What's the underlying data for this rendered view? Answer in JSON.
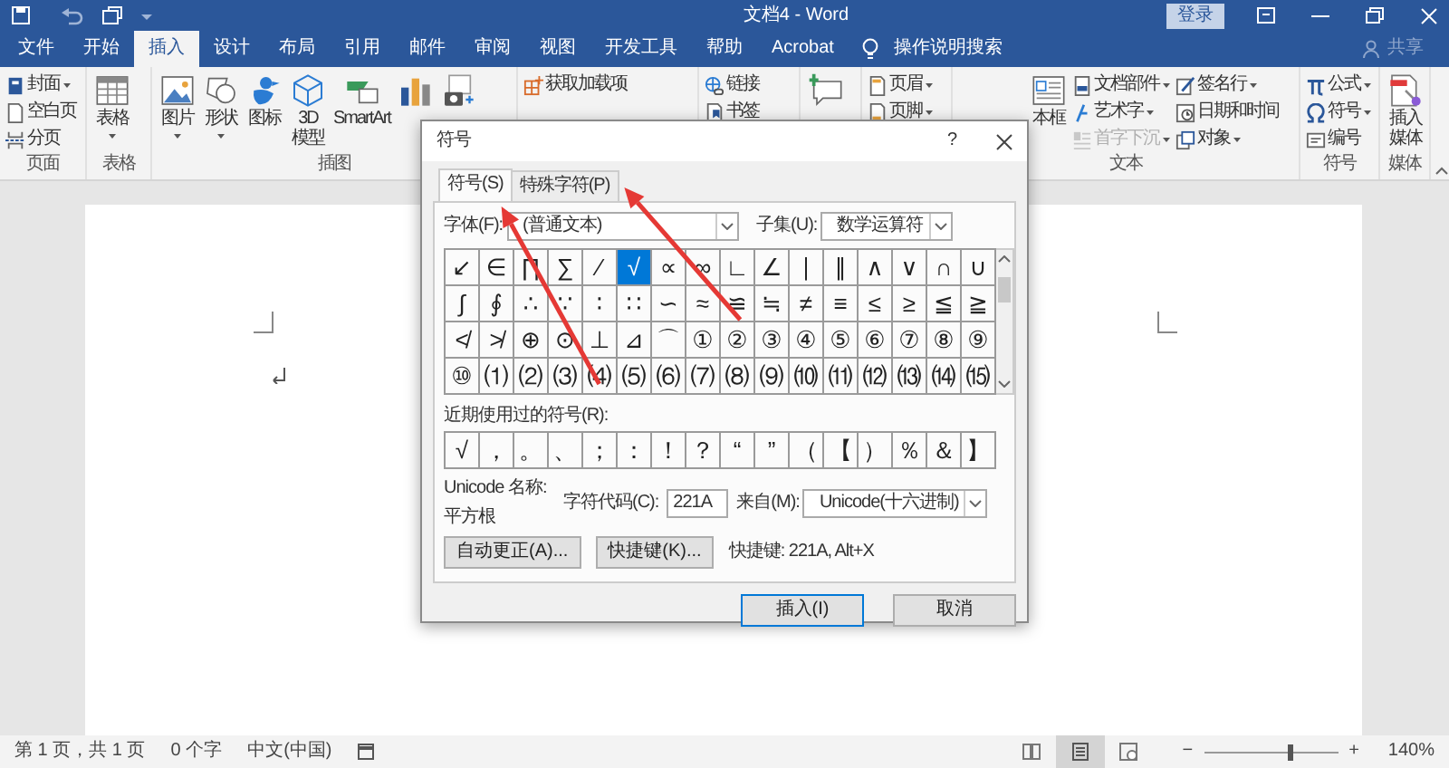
{
  "title_bar": {
    "document_title": "文档4 - Word",
    "login_button": "登录"
  },
  "tabs": [
    {
      "label": "文件",
      "selected": false
    },
    {
      "label": "开始",
      "selected": false
    },
    {
      "label": "插入",
      "selected": true
    },
    {
      "label": "设计",
      "selected": false
    },
    {
      "label": "布局",
      "selected": false
    },
    {
      "label": "引用",
      "selected": false
    },
    {
      "label": "邮件",
      "selected": false
    },
    {
      "label": "审阅",
      "selected": false
    },
    {
      "label": "视图",
      "selected": false
    },
    {
      "label": "开发工具",
      "selected": false
    },
    {
      "label": "帮助",
      "selected": false
    },
    {
      "label": "Acrobat",
      "selected": false
    }
  ],
  "tell_me": "操作说明搜索",
  "share": "共享",
  "ribbon": {
    "groups": [
      {
        "label": "页面",
        "items": [
          {
            "kind": "small",
            "label": "封面",
            "dropdown": true
          },
          {
            "kind": "small",
            "label": "空白页",
            "dropdown": false
          },
          {
            "kind": "small",
            "label": "分页",
            "dropdown": false
          }
        ]
      },
      {
        "label": "表格",
        "items": [
          {
            "kind": "large",
            "label": "表格",
            "dropdown": true
          }
        ]
      },
      {
        "label": "插图",
        "items": [
          {
            "kind": "large",
            "label": "图片",
            "dropdown": true
          },
          {
            "kind": "large",
            "label": "形状",
            "dropdown": true
          },
          {
            "kind": "large",
            "label": "图标",
            "dropdown": false
          },
          {
            "kind": "large",
            "label": "3D\n模型",
            "dropdown": false
          },
          {
            "kind": "large",
            "label": "SmartArt",
            "dropdown": false
          },
          {
            "kind": "icon"
          },
          {
            "kind": "icon"
          }
        ]
      },
      {
        "items": [
          {
            "kind": "small",
            "label": "获取加载项",
            "dropdown": false
          }
        ]
      },
      {
        "items": [
          {
            "kind": "small",
            "label": "链接",
            "dropdown": false
          },
          {
            "kind": "small",
            "label": "书签",
            "dropdown": false
          }
        ]
      },
      {
        "items": [
          {
            "kind": "icon"
          }
        ]
      },
      {
        "items": [
          {
            "kind": "small",
            "label": "页眉",
            "dropdown": true
          },
          {
            "kind": "small",
            "label": "页脚",
            "dropdown": true
          }
        ]
      },
      {
        "label": "文本",
        "items": [
          {
            "kind": "large",
            "label": "本框",
            "dropdown": false,
            "disabled": false
          },
          {
            "kind": "small",
            "label": "文档部件",
            "dropdown": true,
            "disabled": false
          },
          {
            "kind": "small",
            "label": "艺术字",
            "dropdown": true,
            "disabled": false
          },
          {
            "kind": "small",
            "label": "首字下沉",
            "dropdown": true,
            "disabled": true
          },
          {
            "kind": "small",
            "label": "签名行",
            "dropdown": true,
            "disabled": false
          },
          {
            "kind": "small",
            "label": "日期和时间",
            "dropdown": false,
            "disabled": false
          },
          {
            "kind": "small",
            "label": "对象",
            "dropdown": true,
            "disabled": false
          }
        ]
      },
      {
        "label": "符号",
        "items": [
          {
            "kind": "small",
            "label": "公式",
            "dropdown": true
          },
          {
            "kind": "small",
            "label": "符号",
            "dropdown": true
          },
          {
            "kind": "small",
            "label": "编号",
            "dropdown": false
          }
        ]
      },
      {
        "label": "媒体",
        "items": [
          {
            "kind": "large",
            "label": "插入媒体",
            "dropdown": false
          }
        ]
      }
    ]
  },
  "dialog": {
    "title": "符号",
    "help": "?",
    "tabs": [
      {
        "label": "符号(S)",
        "selected": true
      },
      {
        "label": "特殊字符(P)",
        "selected": false
      }
    ],
    "font_label": "字体(F):",
    "font_value": "(普通文本)",
    "subset_label": "子集(U):",
    "subset_value": "数学运算符",
    "symbol_grid": [
      [
        {
          "char": "↙",
          "selected": false
        },
        {
          "char": "∈",
          "selected": false
        },
        {
          "char": "∏",
          "selected": false
        },
        {
          "char": "∑",
          "selected": false
        },
        {
          "char": "∕",
          "selected": false
        },
        {
          "char": "√",
          "selected": true
        },
        {
          "char": "∝",
          "selected": false
        },
        {
          "char": "∞",
          "selected": false
        },
        {
          "char": "∟",
          "selected": false
        },
        {
          "char": "∠",
          "selected": false
        },
        {
          "char": "∣",
          "selected": false
        },
        {
          "char": "∥",
          "selected": false
        },
        {
          "char": "∧",
          "selected": false
        },
        {
          "char": "∨",
          "selected": false
        },
        {
          "char": "∩",
          "selected": false
        },
        {
          "char": "∪",
          "selected": false
        }
      ],
      [
        {
          "char": "∫",
          "selected": false
        },
        {
          "char": "∮",
          "selected": false
        },
        {
          "char": "∴",
          "selected": false
        },
        {
          "char": "∵",
          "selected": false
        },
        {
          "char": "∶",
          "selected": false
        },
        {
          "char": "∷",
          "selected": false
        },
        {
          "char": "∽",
          "selected": false
        },
        {
          "char": "≈",
          "selected": false
        },
        {
          "char": "≌",
          "selected": false
        },
        {
          "char": "≒",
          "selected": false
        },
        {
          "char": "≠",
          "selected": false
        },
        {
          "char": "≡",
          "selected": false
        },
        {
          "char": "≤",
          "selected": false
        },
        {
          "char": "≥",
          "selected": false
        },
        {
          "char": "≦",
          "selected": false
        },
        {
          "char": "≧",
          "selected": false
        }
      ],
      [
        {
          "char": "≮",
          "selected": false
        },
        {
          "char": "≯",
          "selected": false
        },
        {
          "char": "⊕",
          "selected": false
        },
        {
          "char": "⊙",
          "selected": false
        },
        {
          "char": "⊥",
          "selected": false
        },
        {
          "char": "⊿",
          "selected": false
        },
        {
          "char": "⌒",
          "selected": false
        },
        {
          "char": "①",
          "selected": false
        },
        {
          "char": "②",
          "selected": false
        },
        {
          "char": "③",
          "selected": false
        },
        {
          "char": "④",
          "selected": false
        },
        {
          "char": "⑤",
          "selected": false
        },
        {
          "char": "⑥",
          "selected": false
        },
        {
          "char": "⑦",
          "selected": false
        },
        {
          "char": "⑧",
          "selected": false
        },
        {
          "char": "⑨",
          "selected": false
        }
      ],
      [
        {
          "char": "⑩",
          "selected": false
        },
        {
          "char": "⑴",
          "selected": false
        },
        {
          "char": "⑵",
          "selected": false
        },
        {
          "char": "⑶",
          "selected": false
        },
        {
          "char": "⑷",
          "selected": false
        },
        {
          "char": "⑸",
          "selected": false
        },
        {
          "char": "⑹",
          "selected": false
        },
        {
          "char": "⑺",
          "selected": false
        },
        {
          "char": "⑻",
          "selected": false
        },
        {
          "char": "⑼",
          "selected": false
        },
        {
          "char": "⑽",
          "selected": false
        },
        {
          "char": "⑾",
          "selected": false
        },
        {
          "char": "⑿",
          "selected": false
        },
        {
          "char": "⒀",
          "selected": false
        },
        {
          "char": "⒁",
          "selected": false
        },
        {
          "char": "⒂",
          "selected": false
        }
      ]
    ],
    "recent_label": "近期使用过的符号(R):",
    "recent_symbols": [
      "√",
      "，",
      "。",
      "、",
      "；",
      "：",
      "！",
      "？",
      "“",
      "”",
      "（",
      "【",
      "）",
      "％",
      "＆",
      "】"
    ],
    "unicode_name_label": "Unicode 名称:",
    "unicode_name": "平方根",
    "char_code_label": "字符代码(C):",
    "char_code": "221A",
    "from_label": "来自(M):",
    "from_value": "Unicode(十六进制)",
    "autocorrect_button": "自动更正(A)...",
    "shortcut_button": "快捷键(K)...",
    "shortcut_text": "快捷键: 221A, Alt+X",
    "insert_button": "插入(I)",
    "cancel_button": "取消"
  },
  "status_bar": {
    "page": "第 1 页，共 1 页",
    "words": "0 个字",
    "language": "中文(中国)",
    "views": [
      {
        "selected": false
      },
      {
        "selected": true
      },
      {
        "selected": false
      }
    ],
    "zoom_out": "−",
    "zoom_in": "+",
    "zoom_slider": {
      "level": 0.63
    },
    "zoom": "140%"
  }
}
